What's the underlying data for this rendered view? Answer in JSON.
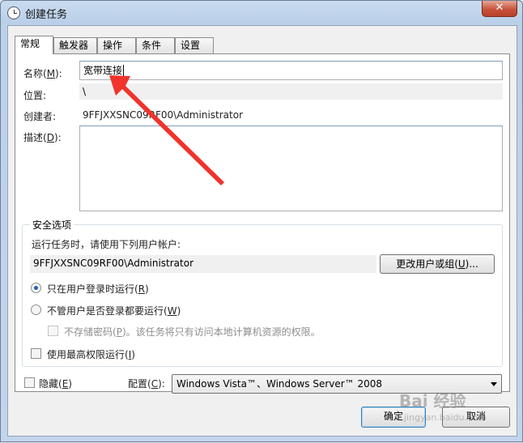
{
  "window": {
    "title": "创建任务",
    "close_label": "✕"
  },
  "tabs": [
    {
      "label": "常规",
      "active": true
    },
    {
      "label": "触发器",
      "active": false
    },
    {
      "label": "操作",
      "active": false
    },
    {
      "label": "条件",
      "active": false
    },
    {
      "label": "设置",
      "active": false
    }
  ],
  "general": {
    "name_label_pre": "名称(",
    "name_label_key": "M",
    "name_label_post": "):",
    "name_value": "宽带连接",
    "location_label": "位置:",
    "location_value": "\\",
    "author_label": "创建者:",
    "author_value": "9FFJXXSNC09RF00\\Administrator",
    "desc_label_pre": "描述(",
    "desc_label_key": "D",
    "desc_label_post": "):",
    "desc_value": ""
  },
  "security": {
    "title": "安全选项",
    "run_as_label": "运行任务时，请使用下列用户帐户:",
    "run_as_value": "9FFJXXSNC09RF00\\Administrator",
    "change_user_btn_pre": "更改用户或组(",
    "change_user_btn_key": "U",
    "change_user_btn_post": ")...",
    "radio_logged_on_pre": "只在用户登录时运行(",
    "radio_logged_on_key": "R",
    "radio_logged_on_post": ")",
    "radio_logged_on_checked": true,
    "radio_any_pre": "不管用户是否登录都要运行(",
    "radio_any_key": "W",
    "radio_any_post": ")",
    "radio_any_checked": false,
    "no_store_pwd_pre": "不存储密码(",
    "no_store_pwd_key": "P",
    "no_store_pwd_post": ")。该任务将只有访问本地计算机资源的权限。",
    "highest_priv_pre": "使用最高权限运行(",
    "highest_priv_key": "I",
    "highest_priv_post": ")"
  },
  "footer": {
    "hidden_pre": "隐藏(",
    "hidden_key": "E",
    "hidden_post": ")",
    "config_label_pre": "配置(",
    "config_label_key": "C",
    "config_label_post": "):",
    "config_value": "Windows Vista™、Windows Server™ 2008",
    "ok_label": "确定",
    "cancel_label": "取消"
  },
  "watermark": {
    "brand": "Bai 经验",
    "url": "jingyan.baidu.com"
  },
  "colors": {
    "annotation_arrow": "#f0332c",
    "radio_dot": "#2160b0"
  }
}
